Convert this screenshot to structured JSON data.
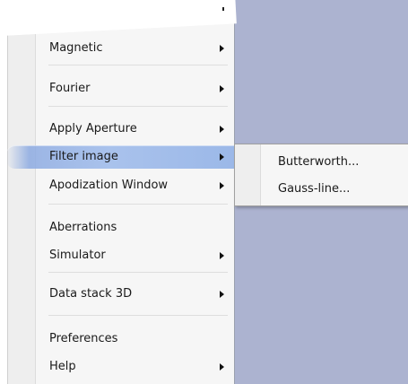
{
  "menu": {
    "items": [
      {
        "label": "Magnetic",
        "has_submenu": true
      },
      {
        "label": "Fourier",
        "has_submenu": true
      },
      {
        "label": "Apply Aperture",
        "has_submenu": true
      },
      {
        "label": "Filter image",
        "has_submenu": true,
        "highlighted": true
      },
      {
        "label": "Apodization Window",
        "has_submenu": true
      },
      {
        "label": "Aberrations",
        "has_submenu": false
      },
      {
        "label": "Simulator",
        "has_submenu": true
      },
      {
        "label": "Data stack 3D",
        "has_submenu": true
      },
      {
        "label": "Preferences",
        "has_submenu": false
      },
      {
        "label": "Help",
        "has_submenu": true
      }
    ]
  },
  "submenu": {
    "items": [
      {
        "label": "Butterworth..."
      },
      {
        "label": "Gauss-line..."
      }
    ]
  },
  "colors": {
    "background": "#acb3d0",
    "menu_bg": "#f6f6f6",
    "highlight": "#a9c2ec"
  }
}
